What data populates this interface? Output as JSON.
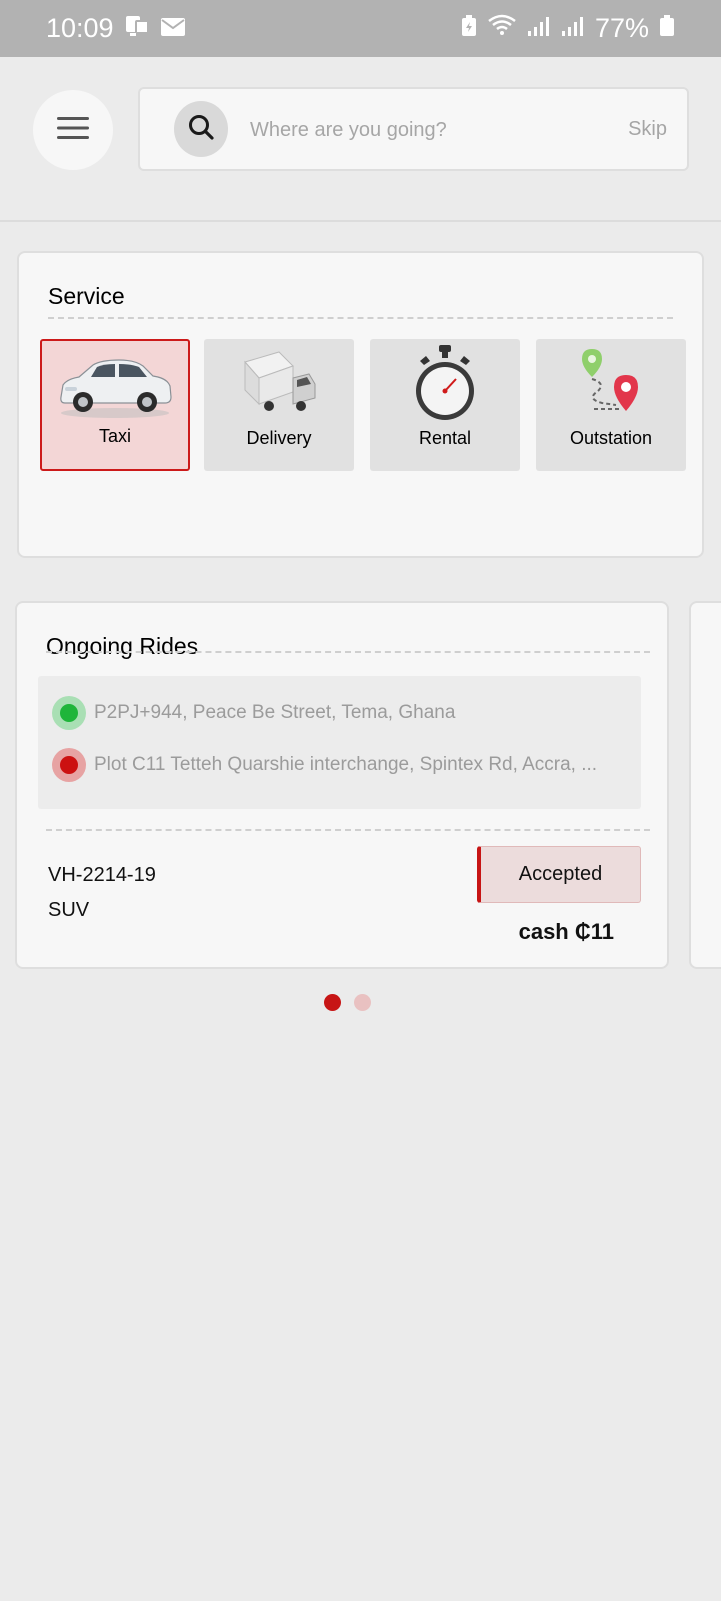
{
  "status_bar": {
    "time": "10:09",
    "battery": "77%",
    "icons": [
      "screen-mirror-icon",
      "mail-icon",
      "battery-saver-icon",
      "wifi-icon",
      "signal-icon",
      "signal-icon",
      "battery-icon"
    ]
  },
  "search": {
    "placeholder": "Where are you going?",
    "skip_label": "Skip",
    "icon": "search-icon",
    "menu_icon": "hamburger-menu-icon"
  },
  "service": {
    "title": "Service",
    "items": [
      {
        "label": "Taxi",
        "icon": "taxi-car-icon",
        "selected": true
      },
      {
        "label": "Delivery",
        "icon": "delivery-truck-icon",
        "selected": false
      },
      {
        "label": "Rental",
        "icon": "stopwatch-icon",
        "selected": false
      },
      {
        "label": "Outstation",
        "icon": "route-pins-icon",
        "selected": false
      }
    ]
  },
  "ongoing_rides": {
    "title": "Ongoing Rides",
    "rides": [
      {
        "pickup": "P2PJ+944, Peace Be Street, Tema, Ghana",
        "dropoff": "Plot C11 Tetteh Quarshie interchange, Spintex Rd, Accra, ...",
        "vehicle_number": "VH-2214-19",
        "vehicle_type": "SUV",
        "status": "Accepted",
        "fare": "cash ₵11"
      }
    ],
    "pager": {
      "count": 2,
      "active_index": 0
    }
  },
  "colors": {
    "accent": "#c71515",
    "pickup_dot": "#1fb53a",
    "dropoff_dot": "#cc1111",
    "selected_tile_bg": "#f3d6d6",
    "background": "#ebebeb",
    "card": "#f7f7f7",
    "status_bar": "#b2b2b2"
  }
}
